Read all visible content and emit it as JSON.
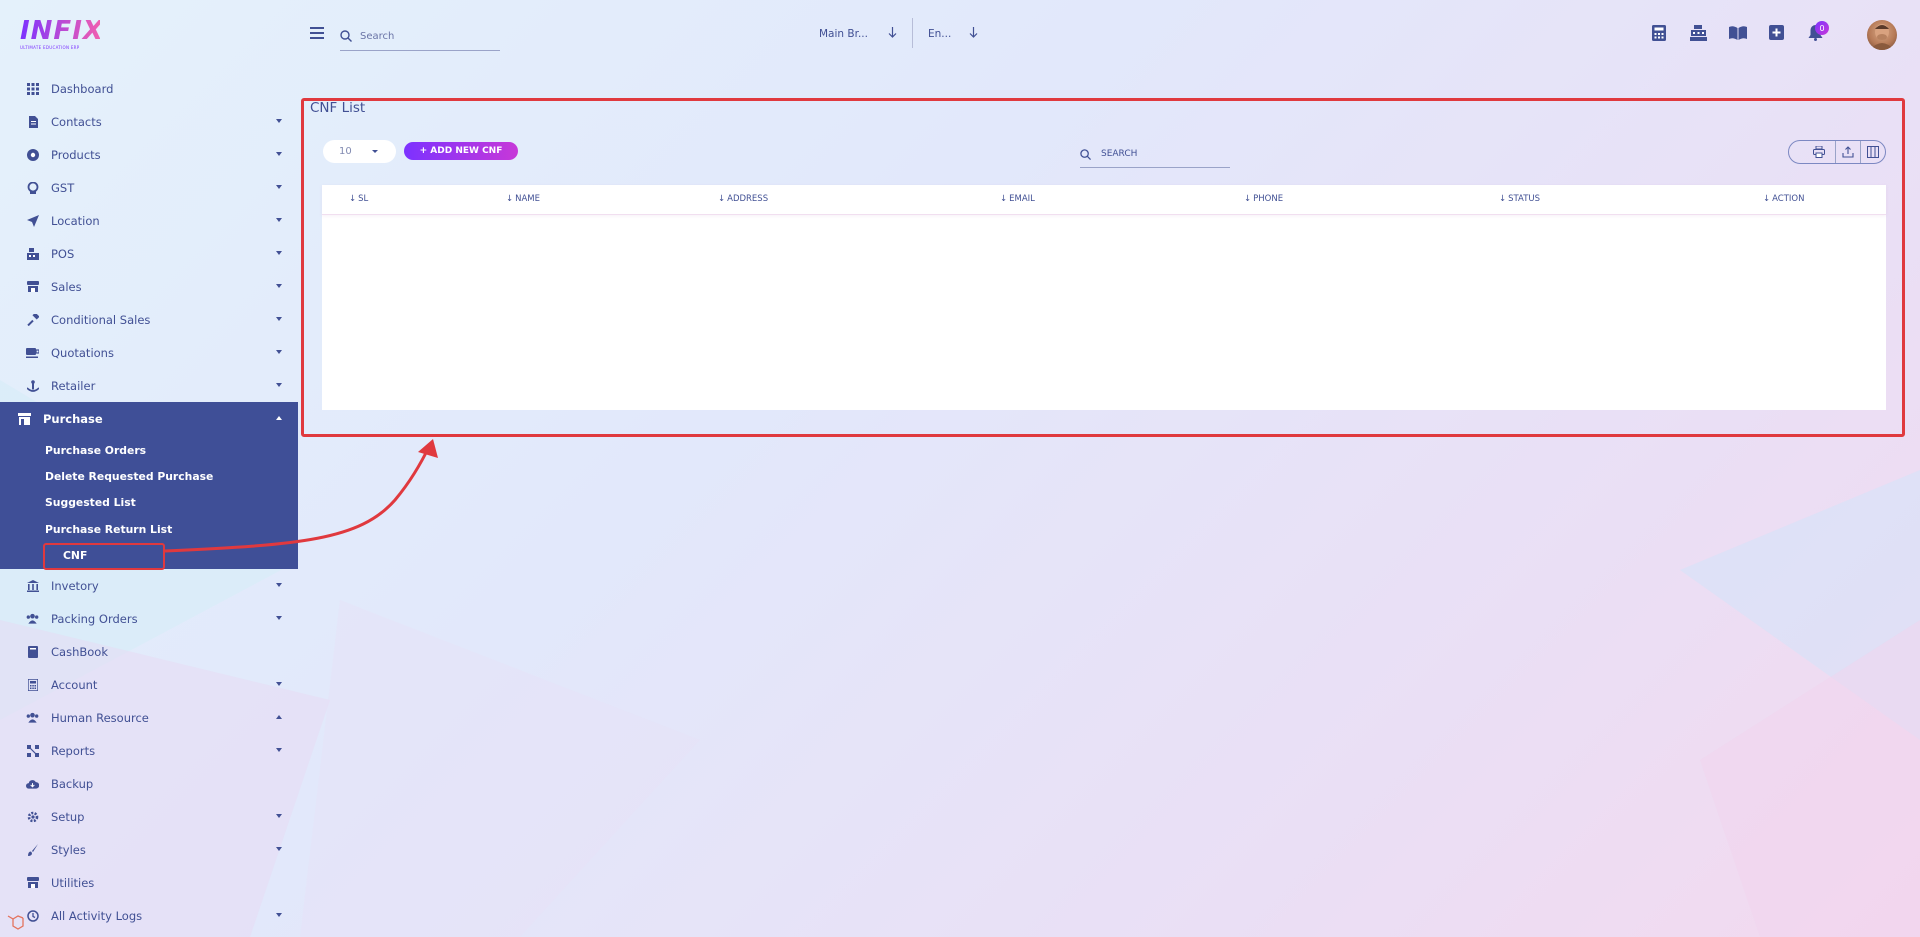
{
  "app": {
    "logo_text": "INFIX",
    "logo_subtitle": "ULTIMATE EDUCATION ERP"
  },
  "sidebar": {
    "items": [
      {
        "label": "Dashboard",
        "icon": "grid-icon",
        "has_caret": false
      },
      {
        "label": "Contacts",
        "icon": "contacts-icon",
        "has_caret": true
      },
      {
        "label": "Products",
        "icon": "products-icon",
        "has_caret": true
      },
      {
        "label": "GST",
        "icon": "gst-icon",
        "has_caret": true
      },
      {
        "label": "Location",
        "icon": "location-icon",
        "has_caret": true
      },
      {
        "label": "POS",
        "icon": "pos-icon",
        "has_caret": true
      },
      {
        "label": "Sales",
        "icon": "sales-icon",
        "has_caret": true
      },
      {
        "label": "Conditional Sales",
        "icon": "gavel-icon",
        "has_caret": true
      },
      {
        "label": "Quotations",
        "icon": "quotation-icon",
        "has_caret": true
      },
      {
        "label": "Retailer",
        "icon": "retailer-icon",
        "has_caret": true
      }
    ],
    "purchase": {
      "label": "Purchase",
      "icon": "store-icon",
      "subitems": [
        "Purchase Orders",
        "Delete Requested Purchase",
        "Suggested List",
        "Purchase Return List",
        "CNF"
      ]
    },
    "items_after": [
      {
        "label": "Invetory",
        "icon": "bank-icon",
        "caret": "down"
      },
      {
        "label": "Packing Orders",
        "icon": "users-icon",
        "caret": "down"
      },
      {
        "label": "CashBook",
        "icon": "book-icon",
        "caret": ""
      },
      {
        "label": "Account",
        "icon": "calculator-icon",
        "caret": "down"
      },
      {
        "label": "Human Resource",
        "icon": "users-icon",
        "caret": "up"
      },
      {
        "label": "Reports",
        "icon": "reports-icon",
        "caret": "down"
      },
      {
        "label": "Backup",
        "icon": "cloud-icon",
        "caret": ""
      },
      {
        "label": "Setup",
        "icon": "gear-icon",
        "caret": "down"
      },
      {
        "label": "Styles",
        "icon": "brush-icon",
        "caret": "down"
      },
      {
        "label": "Utilities",
        "icon": "utilities-icon",
        "caret": ""
      },
      {
        "label": "All Activity Logs",
        "icon": "logs-icon",
        "caret": "down"
      }
    ]
  },
  "topbar": {
    "search_placeholder": "Search",
    "branch": "Main Br...",
    "language": "En...",
    "notification_count": "0"
  },
  "page": {
    "title": "CNF List",
    "per_page": "10",
    "add_button": "+ ADD NEW CNF",
    "search_placeholder": "SEARCH",
    "columns": [
      "SL",
      "NAME",
      "ADDRESS",
      "EMAIL",
      "PHONE",
      "STATUS",
      "ACTION"
    ]
  },
  "colors": {
    "primary": "#415094",
    "accent_start": "#7c32ff",
    "accent_end": "#c738d8",
    "highlight": "#e0393e"
  }
}
